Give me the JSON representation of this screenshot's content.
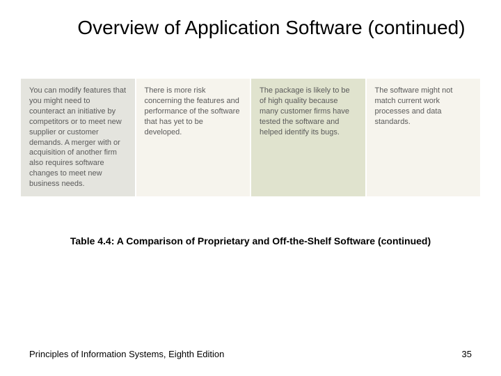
{
  "title": "Overview of Application Software (continued)",
  "cells": [
    "You can modify features that you might need to counteract an initiative by competitors or to meet new supplier or customer demands. A merger with or acquisition of another firm also requires software changes to meet new business needs.",
    "There is more risk concerning the features and performance of the software that has yet to be developed.",
    "The package is likely to be of high quality because many customer firms have tested the software and helped identify its bugs.",
    "The software might not match current work processes and data standards."
  ],
  "caption": "Table 4.4: A Comparison of Proprietary and Off-the-Shelf Software (continued)",
  "footer_left": "Principles of Information Systems, Eighth Edition",
  "footer_right": "35"
}
